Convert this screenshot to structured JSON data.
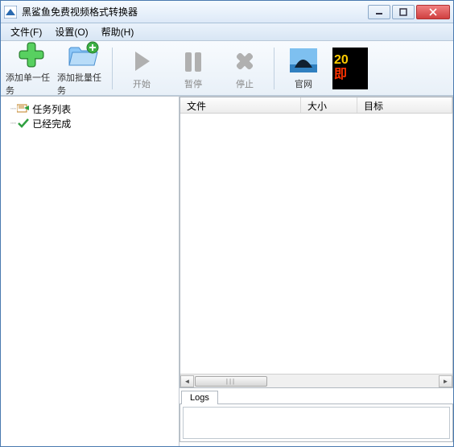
{
  "window": {
    "title": "黑鲨鱼免费视频格式转换器"
  },
  "menu": {
    "file": "文件(F)",
    "settings": "设置(O)",
    "help": "帮助(H)"
  },
  "toolbar": {
    "add_single": "添加单一任务",
    "add_batch": "添加批量任务",
    "start": "开始",
    "pause": "暂停",
    "stop": "停止",
    "website": "官网"
  },
  "sidebar": {
    "task_list": "任务列表",
    "completed": "已经完成"
  },
  "file_columns": {
    "file": "文件",
    "size": "大小",
    "target": "目标"
  },
  "logs": {
    "tab": "Logs"
  },
  "banner": {
    "line1": "20",
    "line2": "即"
  },
  "colors": {
    "accent_green": "#3cb043",
    "accent_blue": "#5aa0e0",
    "disabled_gray": "#b0b0b0",
    "close_red": "#d04040"
  }
}
